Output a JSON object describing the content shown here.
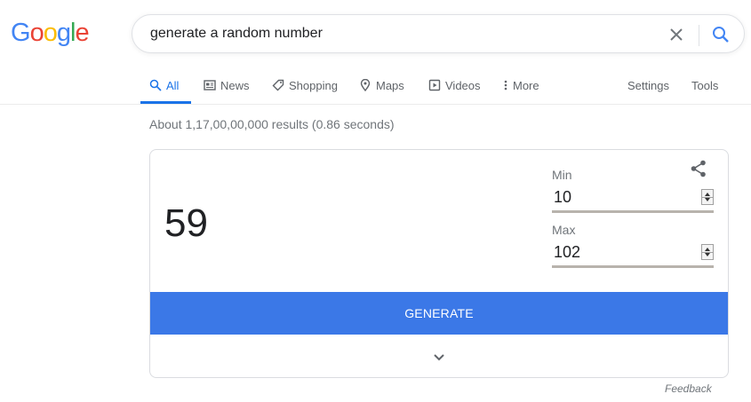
{
  "logo": {
    "letters": [
      "G",
      "o",
      "o",
      "g",
      "l",
      "e"
    ],
    "colors": [
      "#4285f4",
      "#ea4335",
      "#fbbc05",
      "#4285f4",
      "#34a853",
      "#ea4335"
    ]
  },
  "search": {
    "value": "generate a random number",
    "clear_icon": "close-icon",
    "submit_icon": "search-icon"
  },
  "tabs": {
    "all": "All",
    "news": "News",
    "shopping": "Shopping",
    "maps": "Maps",
    "videos": "Videos",
    "more": "More",
    "settings": "Settings",
    "tools": "Tools"
  },
  "stats": "About 1,17,00,00,000 results (0.86 seconds)",
  "generator": {
    "result": "59",
    "min_label": "Min",
    "min_value": "10",
    "max_label": "Max",
    "max_value": "102",
    "button_label": "GENERATE",
    "share_icon": "share-icon",
    "expand_icon": "chevron-down-icon"
  },
  "feedback": "Feedback",
  "colors": {
    "accent": "#1a73e8",
    "button": "#3b78e7",
    "muted": "#70757a"
  }
}
